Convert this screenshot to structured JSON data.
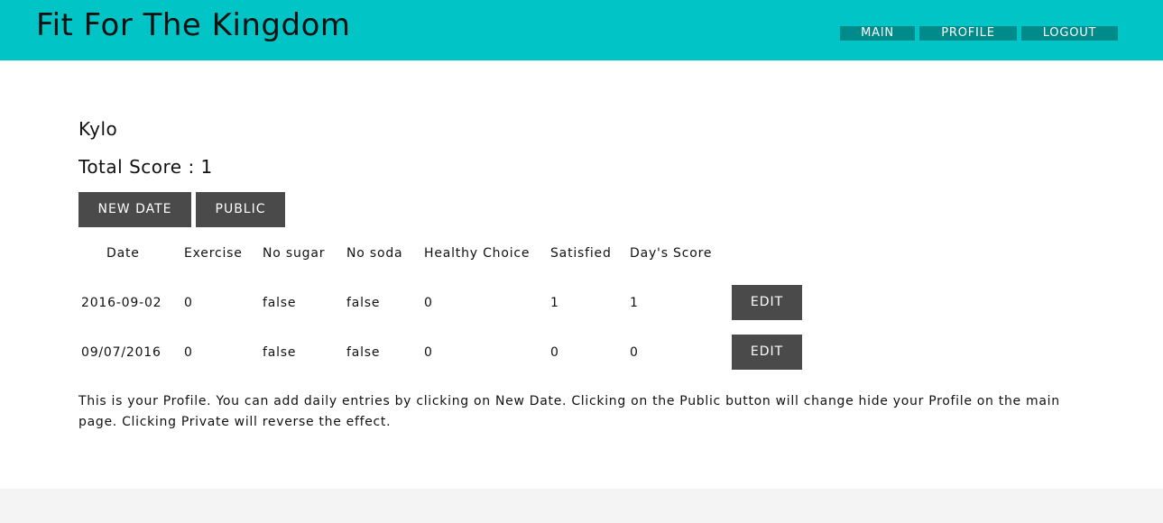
{
  "header": {
    "brand": "Fit For The Kingdom",
    "nav": [
      {
        "label": "MAIN"
      },
      {
        "label": "PROFILE"
      },
      {
        "label": "LOGOUT"
      }
    ]
  },
  "profile": {
    "username": "Kylo",
    "total_score_label": "Total Score : 1"
  },
  "actions": {
    "new_date": "NEW DATE",
    "public": "PUBLIC"
  },
  "table": {
    "columns": [
      "Date",
      "Exercise",
      "No sugar",
      "No soda",
      "Healthy Choice",
      "Satisfied",
      "Day's Score"
    ],
    "rows": [
      {
        "cells": [
          "2016-09-02",
          "0",
          "false",
          "false",
          "0",
          "1",
          "1"
        ],
        "edit": "EDIT"
      },
      {
        "cells": [
          "09/07/2016",
          "0",
          "false",
          "false",
          "0",
          "0",
          "0"
        ],
        "edit": "EDIT"
      }
    ]
  },
  "help_text": "This is your Profile. You can add daily entries by clicking on New Date. Clicking on the Public button will change hide your Profile on the main page. Clicking Private will reverse the effect.",
  "colors": {
    "header_bg": "#00c4c6",
    "nav_bg": "#008b8b",
    "button_bg": "#4a4a4a"
  }
}
